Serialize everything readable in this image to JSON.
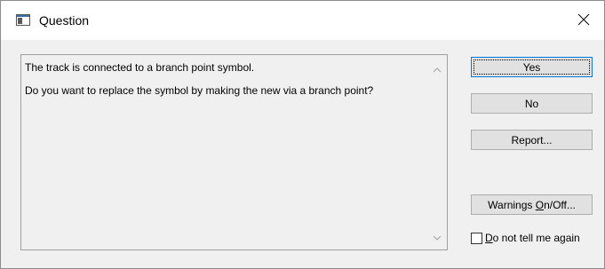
{
  "window": {
    "title": "Question",
    "close_glyph": "✕"
  },
  "message": {
    "line1": "The track is connected to a branch point symbol.",
    "line2": "Do you want to replace the symbol by making the new via a branch point?"
  },
  "buttons": {
    "yes": "Yes",
    "no": "No",
    "report": "Report...",
    "warnings_prefix": "Warnings ",
    "warnings_accel": "O",
    "warnings_suffix": "n/Off..."
  },
  "checkbox": {
    "accel": "D",
    "label_rest": "o not tell me again",
    "checked": false
  },
  "icons": {
    "app": "window-app-icon",
    "close": "close-icon",
    "scroll_up": "scroll-up-icon",
    "scroll_down": "scroll-down-icon"
  }
}
